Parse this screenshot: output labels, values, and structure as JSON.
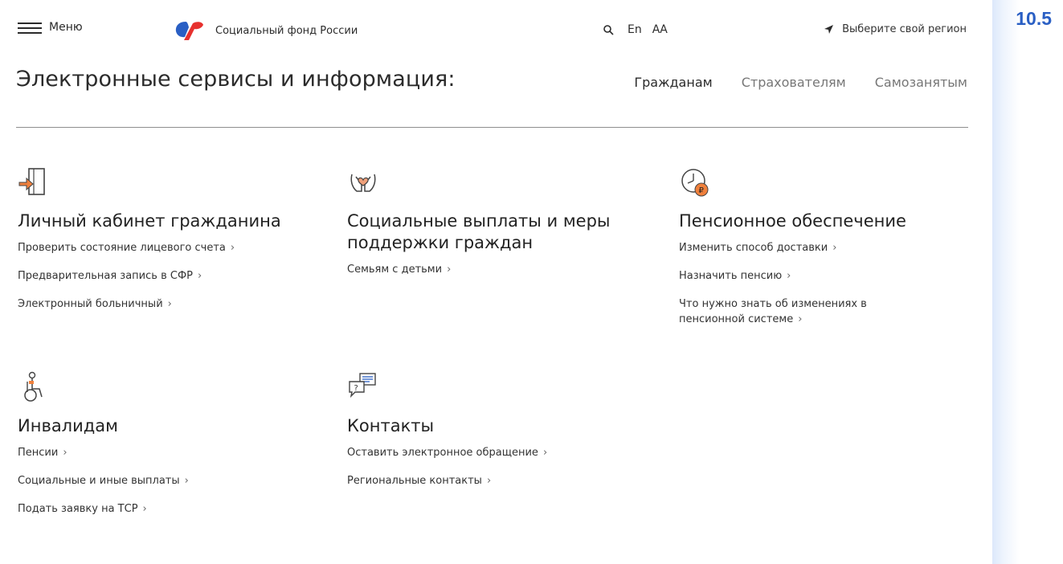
{
  "header": {
    "menu_label": "Меню",
    "logo_text": "Социальный фонд России",
    "lang_label": "En",
    "font_size_label": "АА",
    "region_label": "Выберите свой регион"
  },
  "main": {
    "title": "Электронные сервисы и информация:",
    "audience_tabs": [
      {
        "label": "Гражданам",
        "active": true
      },
      {
        "label": "Страхователям",
        "active": false
      },
      {
        "label": "Самозанятым",
        "active": false
      }
    ]
  },
  "sections": [
    {
      "icon": "door-arrow-icon",
      "title": "Личный кабинет гражданина",
      "links": [
        "Проверить состояние лицевого счета",
        "Предварительная запись в СФР",
        "Электронный больничный"
      ]
    },
    {
      "icon": "hands-heart-icon",
      "title": "Социальные выплаты и меры поддержки граждан",
      "links": [
        "Семьям с детьми"
      ]
    },
    {
      "icon": "clock-ruble-icon",
      "title": "Пенсионное обеспечение",
      "links": [
        "Изменить способ доставки",
        "Назначить пенсию",
        "Что нужно знать об изменениях в пенсионной системе"
      ]
    },
    {
      "icon": "wheelchair-icon",
      "title": "Инвалидам",
      "links": [
        "Пенсии",
        "Социальные и иные выплаты",
        "Подать заявку на ТСР"
      ]
    },
    {
      "icon": "chat-question-icon",
      "title": "Контакты",
      "links": [
        "Оставить электронное обращение",
        "Региональные контакты"
      ]
    }
  ],
  "badge": "10.5",
  "colors": {
    "accent_red": "#e7312e",
    "accent_blue": "#2a5fc4",
    "icon_orange": "#f0803c"
  }
}
